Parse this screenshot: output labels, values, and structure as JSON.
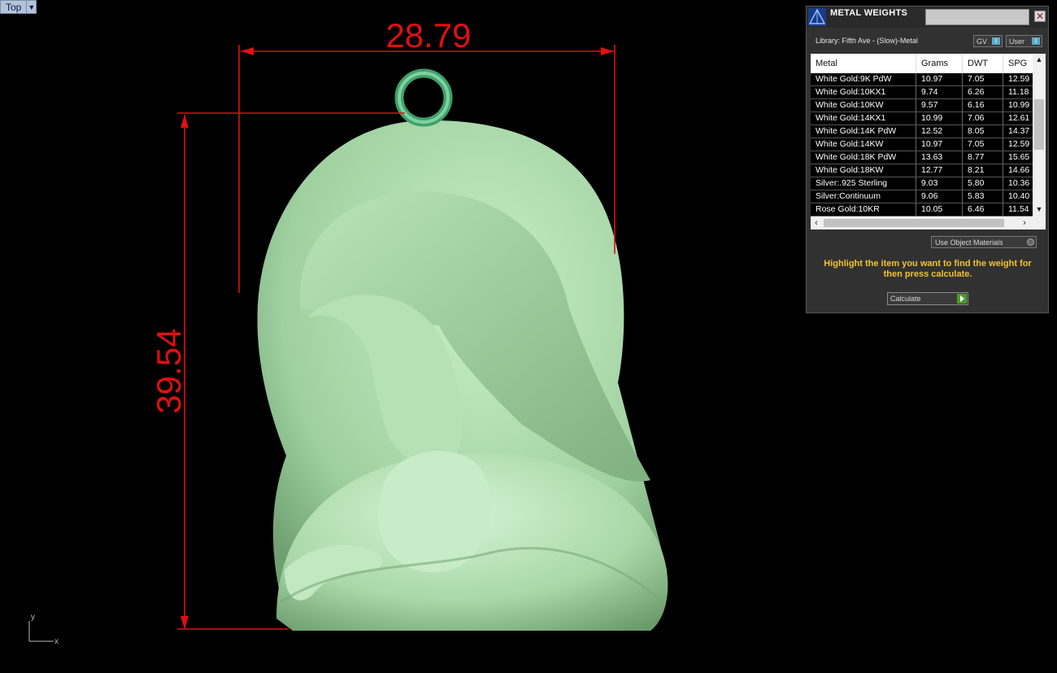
{
  "viewport": {
    "view_name": "Top",
    "dimension_width": "28.79",
    "dimension_height": "39.54",
    "axis_y": "y",
    "axis_x": "x"
  },
  "panel": {
    "title": "METAL WEIGHTS",
    "close_icon": "close-icon",
    "library": "Library: Fifth Ave - (Slow)-Metal",
    "toggle_gv": "GV",
    "toggle_user": "User",
    "toggle_indicator": "I",
    "columns": [
      "Metal",
      "Grams",
      "DWT",
      "SPG"
    ],
    "rows": [
      [
        "White Gold:9K PdW",
        "10.97",
        "7.05",
        "12.59"
      ],
      [
        "White Gold:10KX1",
        "9.74",
        "6.26",
        "11.18"
      ],
      [
        "White Gold:10KW",
        "9.57",
        "6.16",
        "10.99"
      ],
      [
        "White Gold:14KX1",
        "10.99",
        "7.06",
        "12.61"
      ],
      [
        "White Gold:14K PdW",
        "12.52",
        "8.05",
        "14.37"
      ],
      [
        "White Gold:14KW",
        "10.97",
        "7.05",
        "12.59"
      ],
      [
        "White Gold:18K PdW",
        "13.63",
        "8.77",
        "15.65"
      ],
      [
        "White Gold:18KW",
        "12.77",
        "8.21",
        "14.66"
      ],
      [
        "Silver:.925 Sterling",
        "9.03",
        "5.80",
        "10.36"
      ],
      [
        "Silver:Continuum",
        "9.06",
        "5.83",
        "10.40"
      ],
      [
        "Rose Gold:10KR",
        "10.05",
        "6.46",
        "11.54"
      ]
    ],
    "use_object_materials": "Use Object Materials",
    "instructions": "Highlight the item you want to find the weight for then press calculate.",
    "calculate_label": "Calculate"
  },
  "colors": {
    "dimension": "#e01010",
    "model": "#a8d8a8",
    "instructions": "#f2c230"
  }
}
